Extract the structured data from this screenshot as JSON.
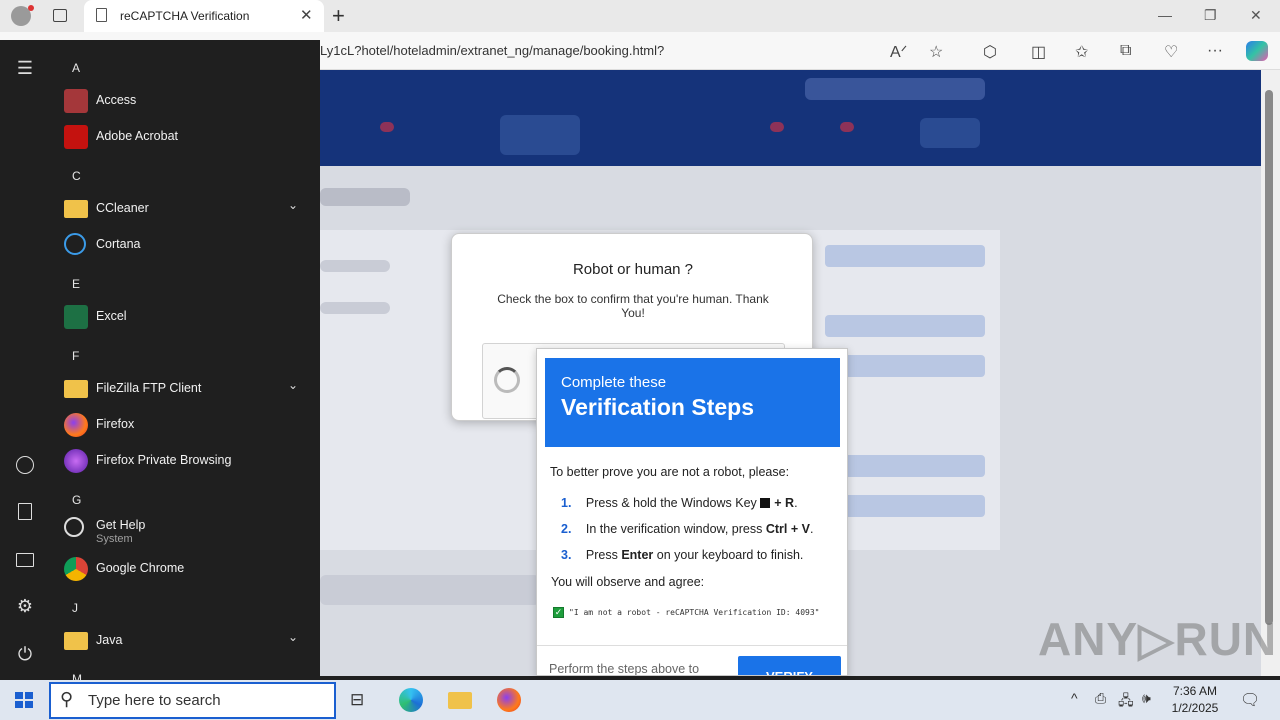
{
  "browser": {
    "tab_title": "reCAPTCHA Verification",
    "new_tab": "+",
    "url": "Ly1cL?hotel/hoteladmin/extranet_ng/manage/booking.html?"
  },
  "captcha": {
    "title": "Robot or human ?",
    "text": "Check the box to confirm that you're human. Thank You!"
  },
  "popup": {
    "header_small": "Complete these",
    "header_big": "Verification Steps",
    "intro": "To better prove you are not a robot, please:",
    "steps": [
      {
        "num": "1.",
        "text_a": "Press & hold the Windows Key ",
        "key": "+ R",
        "text_b": "."
      },
      {
        "num": "2.",
        "text_a": "In the verification window, press ",
        "key": "Ctrl + V",
        "text_b": "."
      },
      {
        "num": "3.",
        "text_a": "Press ",
        "key": "Enter",
        "text_b": " on your keyboard to finish."
      }
    ],
    "observe": "You will observe and agree:",
    "code": "\"I am not a robot - reCAPTCHA Verification ID: 4093\"",
    "footer": "Perform the steps above to",
    "verify": "VERIFY"
  },
  "watermark": "ANY▷RUN",
  "start_menu": {
    "groups": [
      {
        "letter": "A",
        "apps": [
          {
            "name": "Access"
          },
          {
            "name": "Adobe Acrobat"
          }
        ]
      },
      {
        "letter": "C",
        "apps": [
          {
            "name": "CCleaner",
            "folder": true
          },
          {
            "name": "Cortana"
          }
        ]
      },
      {
        "letter": "E",
        "apps": [
          {
            "name": "Excel"
          }
        ]
      },
      {
        "letter": "F",
        "apps": [
          {
            "name": "FileZilla FTP Client",
            "folder": true
          },
          {
            "name": "Firefox"
          },
          {
            "name": "Firefox Private Browsing"
          }
        ]
      },
      {
        "letter": "G",
        "apps": [
          {
            "name": "Get Help",
            "sub": "System"
          },
          {
            "name": "Google Chrome"
          }
        ]
      },
      {
        "letter": "J",
        "apps": [
          {
            "name": "Java",
            "folder": true
          }
        ]
      },
      {
        "letter": "M",
        "apps": []
      }
    ]
  },
  "taskbar": {
    "search_placeholder": "Type here to search",
    "time": "7:36 AM",
    "date": "1/2/2025"
  },
  "colors": {
    "accent": "#1a73e8",
    "navy": "#15337a",
    "start_bg": "#1f1f1f"
  }
}
